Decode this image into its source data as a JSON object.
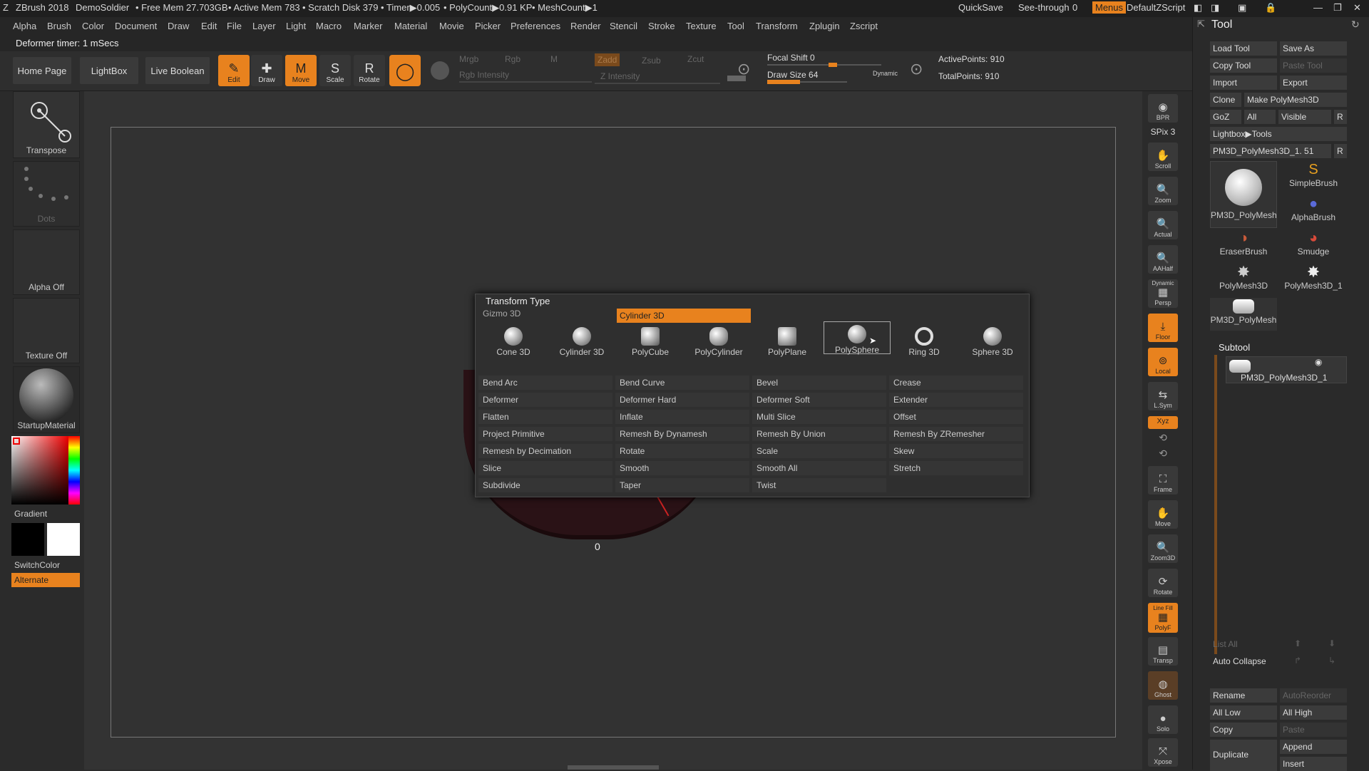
{
  "titlebar": {
    "app": "ZBrush 2018",
    "project": "DemoSoldier",
    "free_mem": "• Free Mem 27.703GB",
    "active_mem": "• Active Mem 783",
    "scratch": "• Scratch Disk 379",
    "timer": "• Timer▶0.005",
    "polycount": "• PolyCount▶0.91 KP",
    "meshcount": "• MeshCount▶1",
    "quicksave": "QuickSave",
    "seethrough": "See-through",
    "seethrough_val": "0",
    "menus": "Menus",
    "script": "DefaultZScript"
  },
  "menubar": [
    "Alpha",
    "Brush",
    "Color",
    "Document",
    "Draw",
    "Edit",
    "File",
    "Layer",
    "Light",
    "Macro",
    "Marker",
    "Material",
    "Movie",
    "Picker",
    "Preferences",
    "Render",
    "Stencil",
    "Stroke",
    "Texture",
    "Tool",
    "Transform",
    "Zplugin",
    "Zscript"
  ],
  "timerbar": {
    "text": "Deformer timer: 1 mSecs"
  },
  "shelf": {
    "home": "Home Page",
    "lightbox": "LightBox",
    "liveboolean": "Live Boolean",
    "edit": "Edit",
    "draw": "Draw",
    "move": "Move",
    "scale": "Scale",
    "rotate": "Rotate",
    "mrgb": "Mrgb",
    "rgb": "Rgb",
    "m": "M",
    "rgb_intensity": "Rgb Intensity",
    "zadd": "Zadd",
    "zsub": "Zsub",
    "zcut": "Zcut",
    "z_intensity": "Z Intensity",
    "focal_shift": "Focal Shift 0",
    "draw_size": "Draw Size 64",
    "dynamic": "Dynamic",
    "active_points": "ActivePoints: 910",
    "total_points": "TotalPoints: 910"
  },
  "leftpanel": {
    "transpose": "Transpose",
    "dots": "Dots",
    "alpha": "Alpha Off",
    "texture": "Texture Off",
    "material": "StartupMaterial",
    "gradient": "Gradient",
    "switchcolor": "SwitchColor",
    "alternate": "Alternate"
  },
  "viewport": {
    "label_zero": "0"
  },
  "rightstrip": [
    "BPR",
    "SPix 3",
    "Scroll",
    "Zoom",
    "Actual",
    "AAHalf",
    "Persp",
    "Floor",
    "Local",
    "L.Sym",
    "Xyz",
    "Frame",
    "Move",
    "Zoom3D",
    "Rotate",
    "PolyF",
    "Transp",
    "Ghost",
    "Solo",
    "Xpose"
  ],
  "rightstrip_top": {
    "dynamic": "Dynamic",
    "linefill": "Line Fill"
  },
  "toolpanel": {
    "title": "Tool",
    "load_tool": "Load Tool",
    "save_as": "Save As",
    "copy_tool": "Copy Tool",
    "paste_tool": "Paste Tool",
    "import": "Import",
    "export": "Export",
    "clone": "Clone",
    "make_polymesh": "Make PolyMesh3D",
    "goz": "GoZ",
    "all": "All",
    "visible": "Visible",
    "r": "R",
    "lightbox_tools": "Lightbox▶Tools",
    "current_tool": "PM3D_PolyMesh3D_1. 51",
    "tools": [
      "PM3D_PolyMesh",
      "SimpleBrush",
      "AlphaBrush",
      "EraserBrush",
      "Smudge",
      "PolyMesh3D",
      "PolyMesh3D_1",
      "PM3D_PolyMesh"
    ],
    "subtool": "Subtool",
    "subtool_item": "PM3D_PolyMesh3D_1",
    "list_all": "List All",
    "auto_collapse": "Auto Collapse",
    "rename": "Rename",
    "autoreorder": "AutoReorder",
    "all_low": "All Low",
    "all_high": "All High",
    "copy": "Copy",
    "paste": "Paste",
    "duplicate": "Duplicate",
    "append": "Append",
    "insert": "Insert"
  },
  "popup": {
    "title": "Transform Type",
    "gizmo": "Gizmo 3D",
    "selected": "Cylinder 3D",
    "primitives": [
      "Cone 3D",
      "Cylinder 3D",
      "PolyCube",
      "PolyCylinder",
      "PolyPlane",
      "PolySphere",
      "Ring 3D",
      "Sphere 3D"
    ],
    "operations": [
      "Bend Arc",
      "Bend Curve",
      "Bevel",
      "Crease",
      "Deformer",
      "Deformer Hard",
      "Deformer Soft",
      "Extender",
      "Flatten",
      "Inflate",
      "Multi Slice",
      "Offset",
      "Project Primitive",
      "Remesh By Dynamesh",
      "Remesh By Union",
      "Remesh By ZRemesher",
      "Remesh by Decimation",
      "Rotate",
      "Scale",
      "Skew",
      "Slice",
      "Smooth",
      "Smooth All",
      "Stretch",
      "Subdivide",
      "Taper",
      "Twist"
    ]
  },
  "colors": {
    "accent": "#e8821e",
    "panel": "#2b2b2b"
  }
}
